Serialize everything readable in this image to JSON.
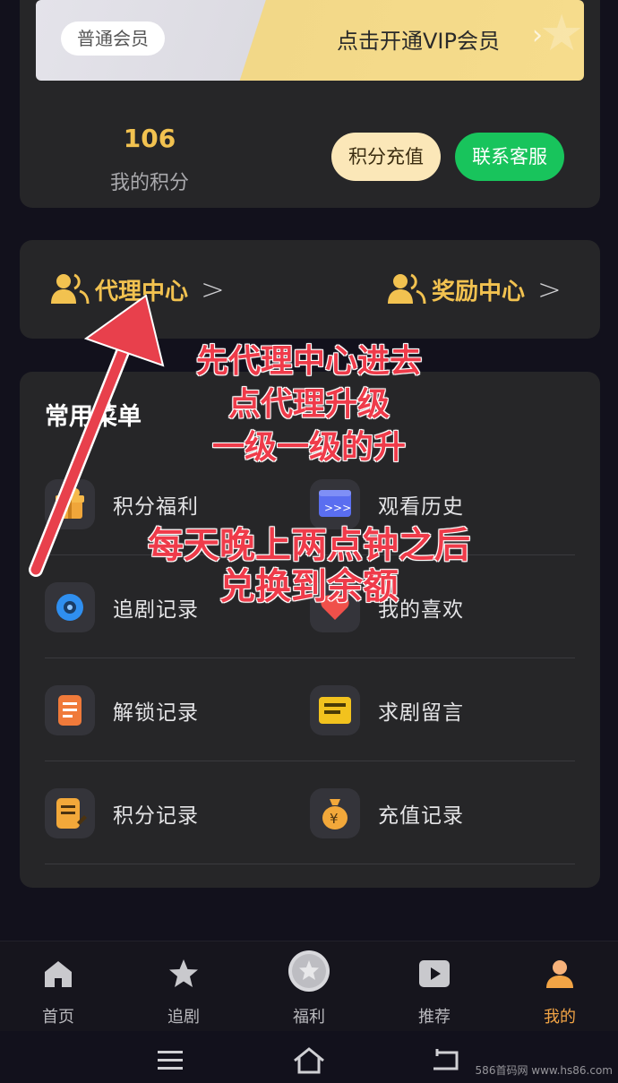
{
  "member": {
    "tag": "普通会员",
    "vip_cta": "点击开通VIP会员",
    "points_value": "106",
    "points_label": "我的积分",
    "recharge_label": "积分充值",
    "service_label": "联系客服"
  },
  "centers": {
    "agent_label": "代理中心",
    "reward_label": "奖励中心"
  },
  "menu": {
    "title": "常用菜单",
    "items": [
      {
        "label": "积分福利",
        "icon": "gift-icon"
      },
      {
        "label": "观看历史",
        "icon": "history-icon"
      },
      {
        "label": "追剧记录",
        "icon": "record-icon"
      },
      {
        "label": "我的喜欢",
        "icon": "heart-icon"
      },
      {
        "label": "解锁记录",
        "icon": "unlock-record-icon"
      },
      {
        "label": "求剧留言",
        "icon": "message-icon"
      },
      {
        "label": "积分记录",
        "icon": "points-record-icon"
      },
      {
        "label": "充值记录",
        "icon": "money-bag-icon"
      }
    ]
  },
  "tabbar": {
    "items": [
      {
        "label": "首页",
        "icon": "home-icon"
      },
      {
        "label": "追剧",
        "icon": "star-icon"
      },
      {
        "label": "福利",
        "icon": "welfare-icon"
      },
      {
        "label": "推荐",
        "icon": "play-icon"
      },
      {
        "label": "我的",
        "icon": "user-icon",
        "active": true
      }
    ]
  },
  "annotations": {
    "line1": "先代理中心进去",
    "line2": "点代理升级",
    "line3": "一级一级的升",
    "line4": "每天晚上两点钟之后",
    "line5": "兑换到余额"
  },
  "watermark": "586首码网 www.hs86.com",
  "colors": {
    "accent_gold": "#f2c250",
    "service_green": "#18c45c",
    "annotation_red": "#ef3b4a",
    "active_tab": "#f2a445"
  }
}
